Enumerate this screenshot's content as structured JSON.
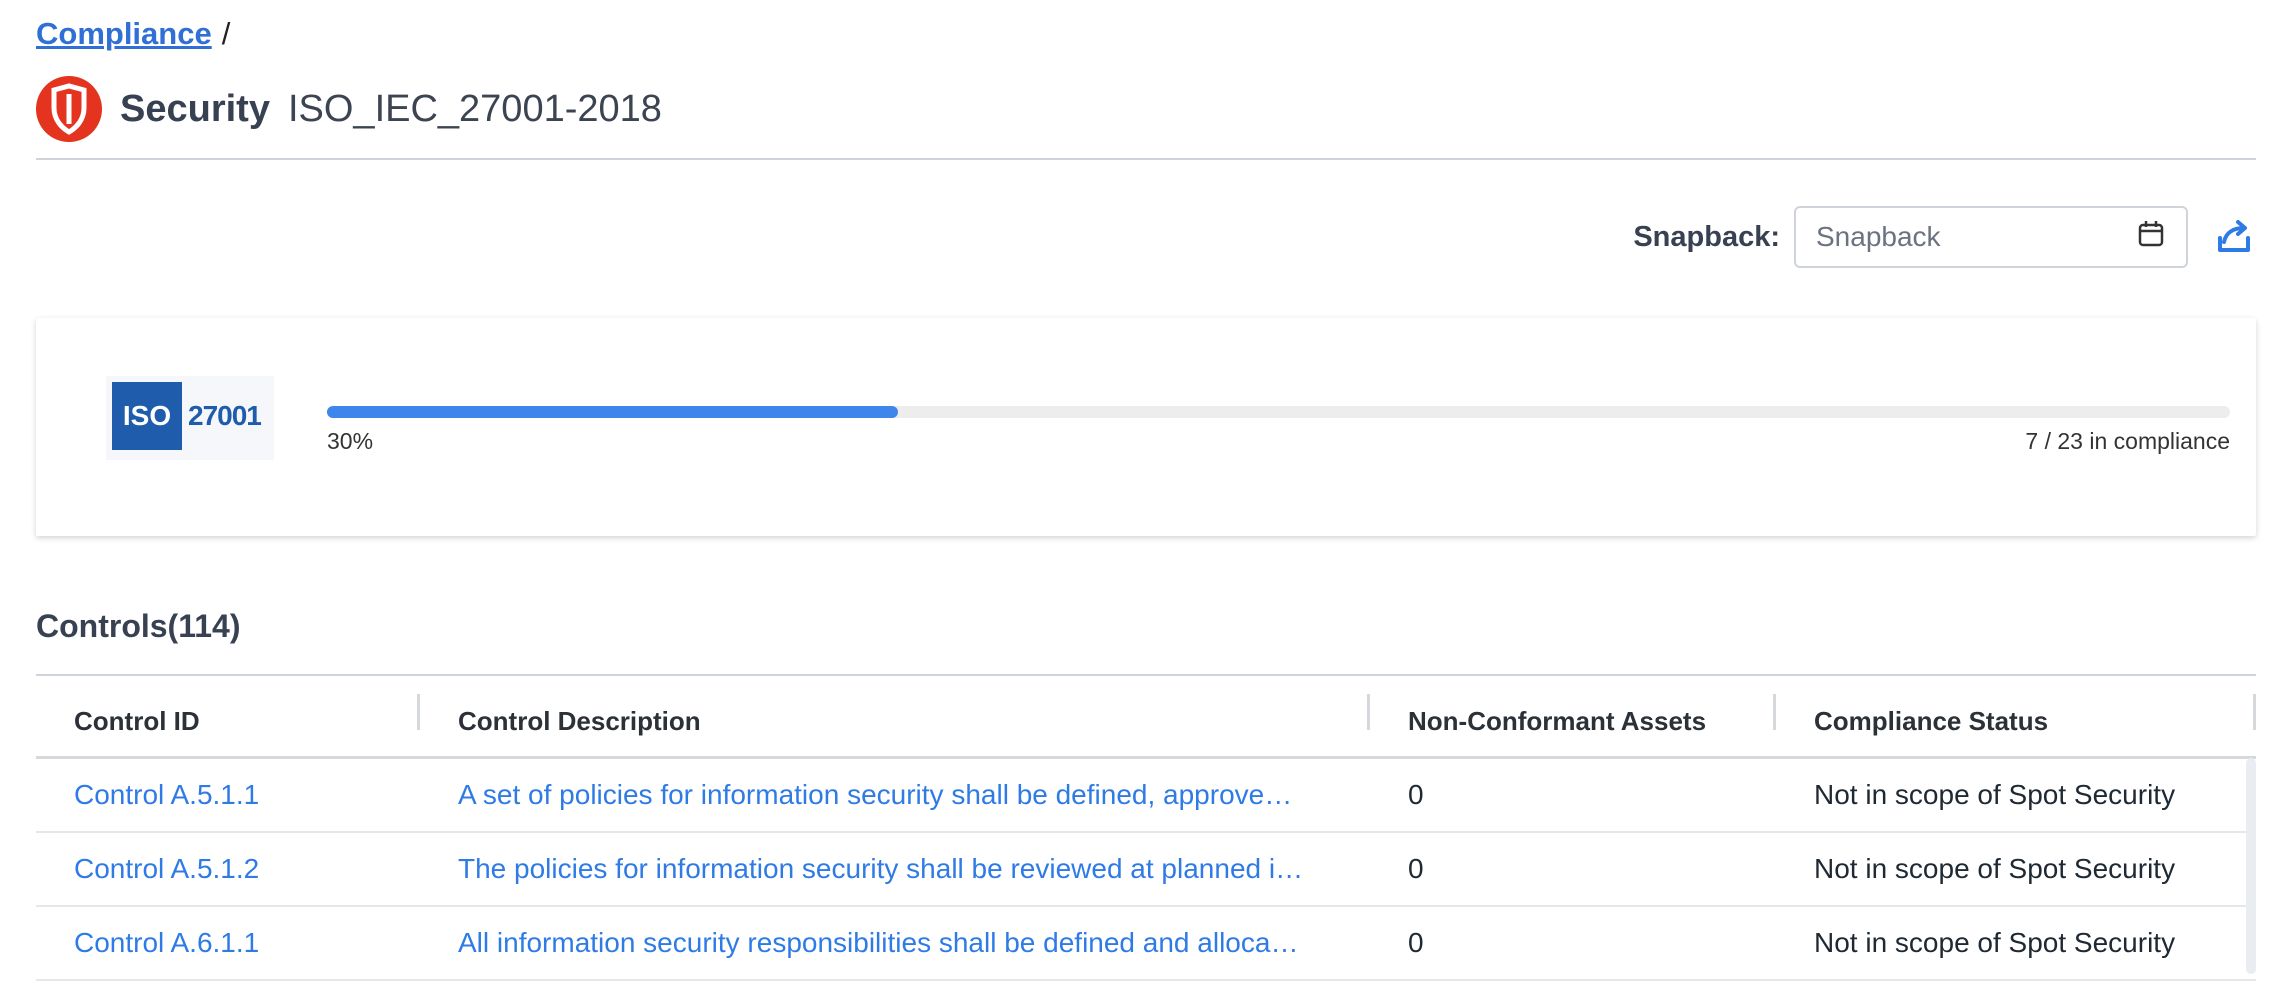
{
  "breadcrumb": {
    "link": "Compliance",
    "separator": "/"
  },
  "header": {
    "title": "Security",
    "standard": "ISO_IEC_27001-2018"
  },
  "snapback": {
    "label": "Snapback:",
    "placeholder": "Snapback"
  },
  "summary": {
    "logo_box": "ISO",
    "logo_number": "27001",
    "progress_percent": 30,
    "progress_label": "30%",
    "compliance_text": "7 / 23 in compliance"
  },
  "controls": {
    "title": "Controls(114)",
    "columns": [
      "Control ID",
      "Control Description",
      "Non-Conformant Assets",
      "Compliance Status"
    ],
    "rows": [
      {
        "id": "Control A.5.1.1",
        "description": "A set of policies for information security shall be defined, approve…",
        "assets": "0",
        "status": "Not in scope of Spot Security"
      },
      {
        "id": "Control A.5.1.2",
        "description": "The policies for information security shall be reviewed at planned i…",
        "assets": "0",
        "status": "Not in scope of Spot Security"
      },
      {
        "id": "Control A.6.1.1",
        "description": "All information security responsibilities shall be defined and alloca…",
        "assets": "0",
        "status": "Not in scope of Spot Security"
      }
    ]
  },
  "colors": {
    "accent": "#2f7be6",
    "brand_red": "#e4331f",
    "progress": "#3f86ec"
  },
  "icons": {
    "shield": "shield-icon",
    "calendar": "calendar-icon",
    "export": "export-icon"
  }
}
